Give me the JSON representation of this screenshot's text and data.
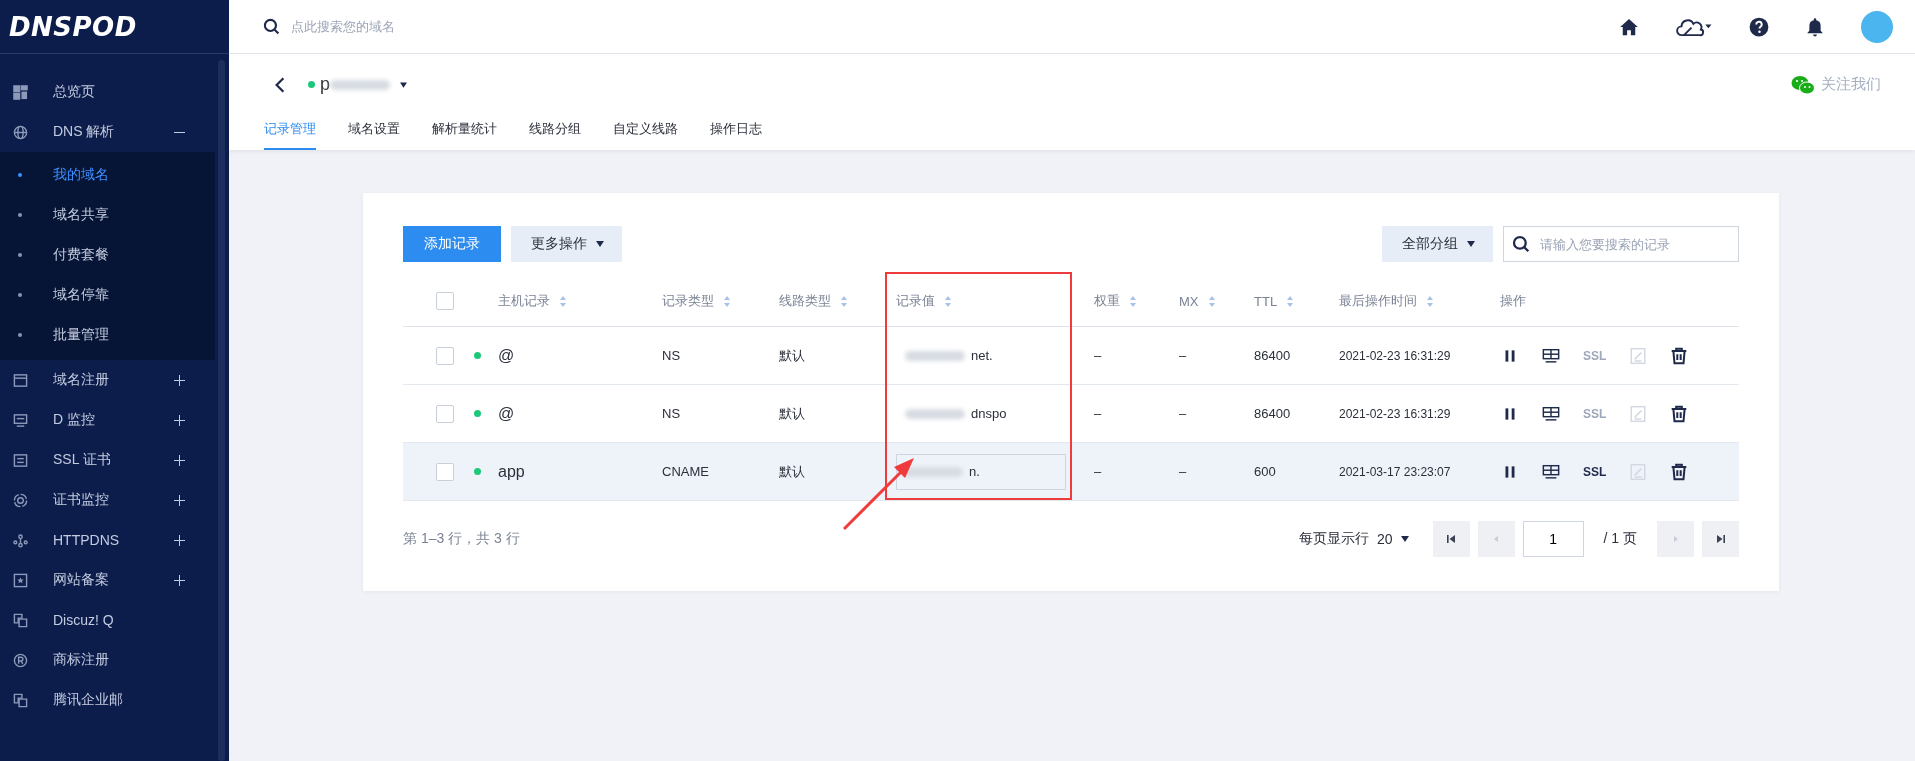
{
  "sidebar": {
    "logo": "DNSPOD",
    "items": [
      {
        "label": "总览页",
        "kind": "grid"
      },
      {
        "label": "DNS 解析",
        "kind": "globe",
        "expanded": true,
        "children": [
          {
            "label": "我的域名",
            "selected": true
          },
          {
            "label": "域名共享",
            "selected": false
          },
          {
            "label": "付费套餐",
            "selected": false
          },
          {
            "label": "域名停靠",
            "selected": false
          },
          {
            "label": "批量管理",
            "selected": false
          }
        ]
      },
      {
        "label": "域名注册",
        "kind": "window",
        "expanded": false
      },
      {
        "label": "D 监控",
        "kind": "monitor",
        "expanded": false
      },
      {
        "label": "SSL 证书",
        "kind": "doc",
        "expanded": false
      },
      {
        "label": "证书监控",
        "kind": "target",
        "expanded": false
      },
      {
        "label": "HTTPDNS",
        "kind": "nodes",
        "expanded": false
      },
      {
        "label": "网站备案",
        "kind": "star",
        "expanded": false
      },
      {
        "label": "Discuz! Q",
        "kind": "squares"
      },
      {
        "label": "商标注册",
        "kind": "registered"
      },
      {
        "label": "腾讯企业邮",
        "kind": "squares"
      }
    ]
  },
  "header": {
    "search": {
      "placeholder": "点此搜索您的域名"
    }
  },
  "domain": {
    "name": "p",
    "active": true,
    "follow": "关注我们"
  },
  "tabs": [
    {
      "label": "记录管理",
      "selected": true
    },
    {
      "label": "域名设置",
      "selected": false
    },
    {
      "label": "解析量统计",
      "selected": false
    },
    {
      "label": "线路分组",
      "selected": false
    },
    {
      "label": "自定义线路",
      "selected": false
    },
    {
      "label": "操作日志",
      "selected": false
    }
  ],
  "toolbar": {
    "add": "添加记录",
    "more": "更多操作",
    "group": "全部分组",
    "search_placeholder": "请输入您要搜索的记录"
  },
  "table": {
    "select_all": false,
    "columns": [
      {
        "label": "主机记录",
        "sortable": true
      },
      {
        "label": "记录类型",
        "sortable": true
      },
      {
        "label": "线路类型",
        "sortable": true
      },
      {
        "label": "记录值",
        "sortable": true
      },
      {
        "label": "权重",
        "sortable": true
      },
      {
        "label": "MX",
        "sortable": true
      },
      {
        "label": "TTL",
        "sortable": true
      },
      {
        "label": "最后操作时间",
        "sortable": true
      },
      {
        "label": "操作",
        "sortable": false
      }
    ],
    "rows": [
      {
        "checked": false,
        "enabled": true,
        "host": "@",
        "type": "NS",
        "line": "默认",
        "value": "net.",
        "weight": "–",
        "mx": "–",
        "ttl": "86400",
        "updated": "2021-02-23 16:31:29",
        "ssl": "SSL",
        "ssl_enabled": false,
        "highlighted": false,
        "editing": false
      },
      {
        "checked": false,
        "enabled": true,
        "host": "@",
        "type": "NS",
        "line": "默认",
        "value": "dnspo",
        "weight": "–",
        "mx": "–",
        "ttl": "86400",
        "updated": "2021-02-23 16:31:29",
        "ssl": "SSL",
        "ssl_enabled": false,
        "highlighted": false,
        "editing": false
      },
      {
        "checked": false,
        "enabled": true,
        "host": "app",
        "type": "CNAME",
        "line": "默认",
        "value": "n.",
        "weight": "–",
        "mx": "–",
        "ttl": "600",
        "updated": "2021-03-17 23:23:07",
        "ssl": "SSL",
        "ssl_enabled": true,
        "highlighted": true,
        "editing": true
      }
    ]
  },
  "pagination": {
    "summary": "第 1–3 行，共 3 行",
    "per_page_label": "每页显示行",
    "per_page": "20",
    "page": "1",
    "total": "/ 1 页",
    "first_disabled": false,
    "prev_disabled": true,
    "next_disabled": true,
    "last_disabled": false
  }
}
